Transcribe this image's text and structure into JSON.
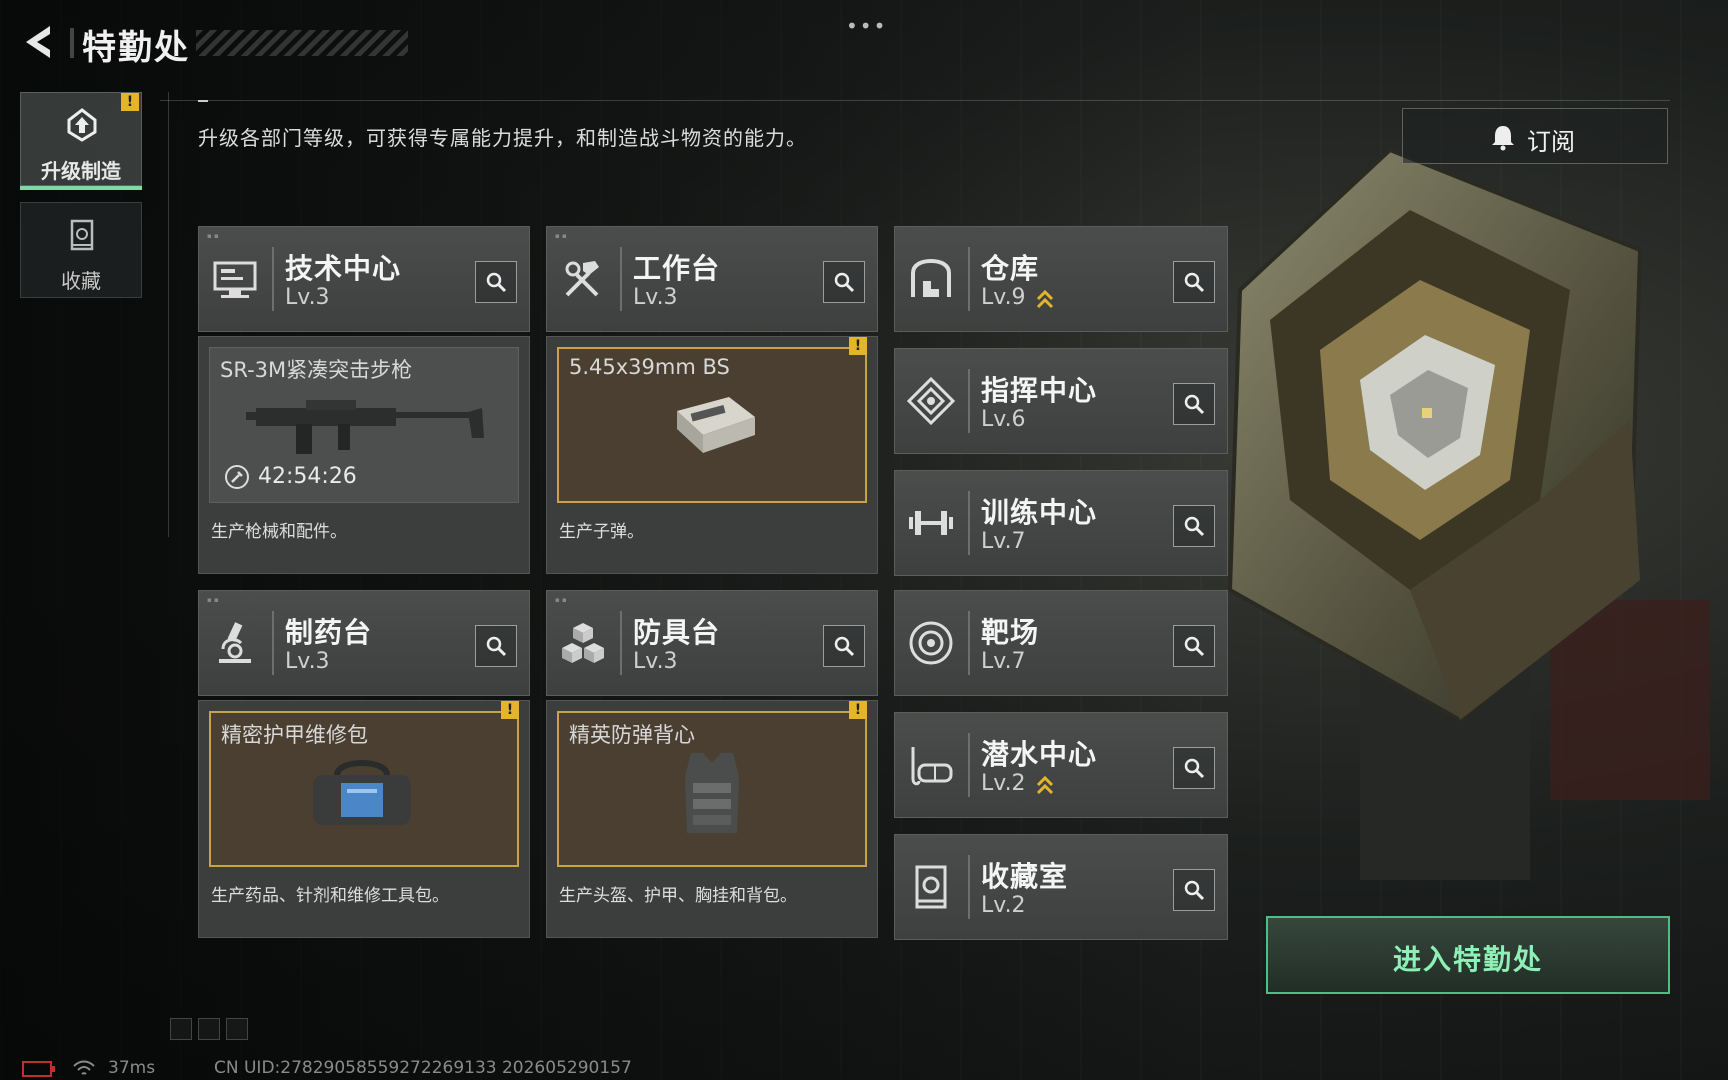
{
  "header": {
    "title": "特勤处",
    "more": "•••",
    "description": "升级各部门等级，可获得专属能力提升，和制造战斗物资的能力。"
  },
  "nav": [
    {
      "label": "升级制造",
      "icon": "upgrade-icon",
      "active": true,
      "badge": "!"
    },
    {
      "label": "收藏",
      "icon": "collection-icon",
      "active": false
    }
  ],
  "subscribe": {
    "label": "订阅",
    "icon": "bell-icon"
  },
  "production": [
    {
      "name": "技术中心",
      "level": "Lv.3",
      "icon": "computer-icon",
      "item": "SR-3M紧凑突击步枪",
      "timer": "42:54:26",
      "highlight": false,
      "desc": "生产枪械和配件。"
    },
    {
      "name": "工作台",
      "level": "Lv.3",
      "icon": "tools-icon",
      "item": "5.45x39mm BS",
      "highlight": true,
      "badge": "!",
      "desc": "生产子弹。"
    },
    {
      "name": "制药台",
      "level": "Lv.3",
      "icon": "microscope-icon",
      "item": "精密护甲维修包",
      "highlight": true,
      "badge": "!",
      "desc": "生产药品、针剂和维修工具包。"
    },
    {
      "name": "防具台",
      "level": "Lv.3",
      "icon": "armor-cubes-icon",
      "item": "精英防弹背心",
      "highlight": true,
      "badge": "!",
      "desc": "生产头盔、护甲、胸挂和背包。"
    }
  ],
  "facilities": [
    {
      "name": "仓库",
      "level": "Lv.9",
      "icon": "warehouse-icon",
      "upgradable": true
    },
    {
      "name": "指挥中心",
      "level": "Lv.6",
      "icon": "command-icon",
      "upgradable": false
    },
    {
      "name": "训练中心",
      "level": "Lv.7",
      "icon": "dumbbell-icon",
      "upgradable": false
    },
    {
      "name": "靶场",
      "level": "Lv.7",
      "icon": "target-icon",
      "upgradable": false
    },
    {
      "name": "潜水中心",
      "level": "Lv.2",
      "icon": "diving-mask-icon",
      "upgradable": true
    },
    {
      "name": "收藏室",
      "level": "Lv.2",
      "icon": "collection-room-icon",
      "upgradable": false
    }
  ],
  "enter_button": "进入特勤处",
  "footer": {
    "ping": "37ms",
    "uid": "CN UID:27829058559272269133 202605290157"
  },
  "colors": {
    "accent_green": "#4bbf84",
    "gold": "#c9a24a",
    "badge": "#e4b52a"
  }
}
